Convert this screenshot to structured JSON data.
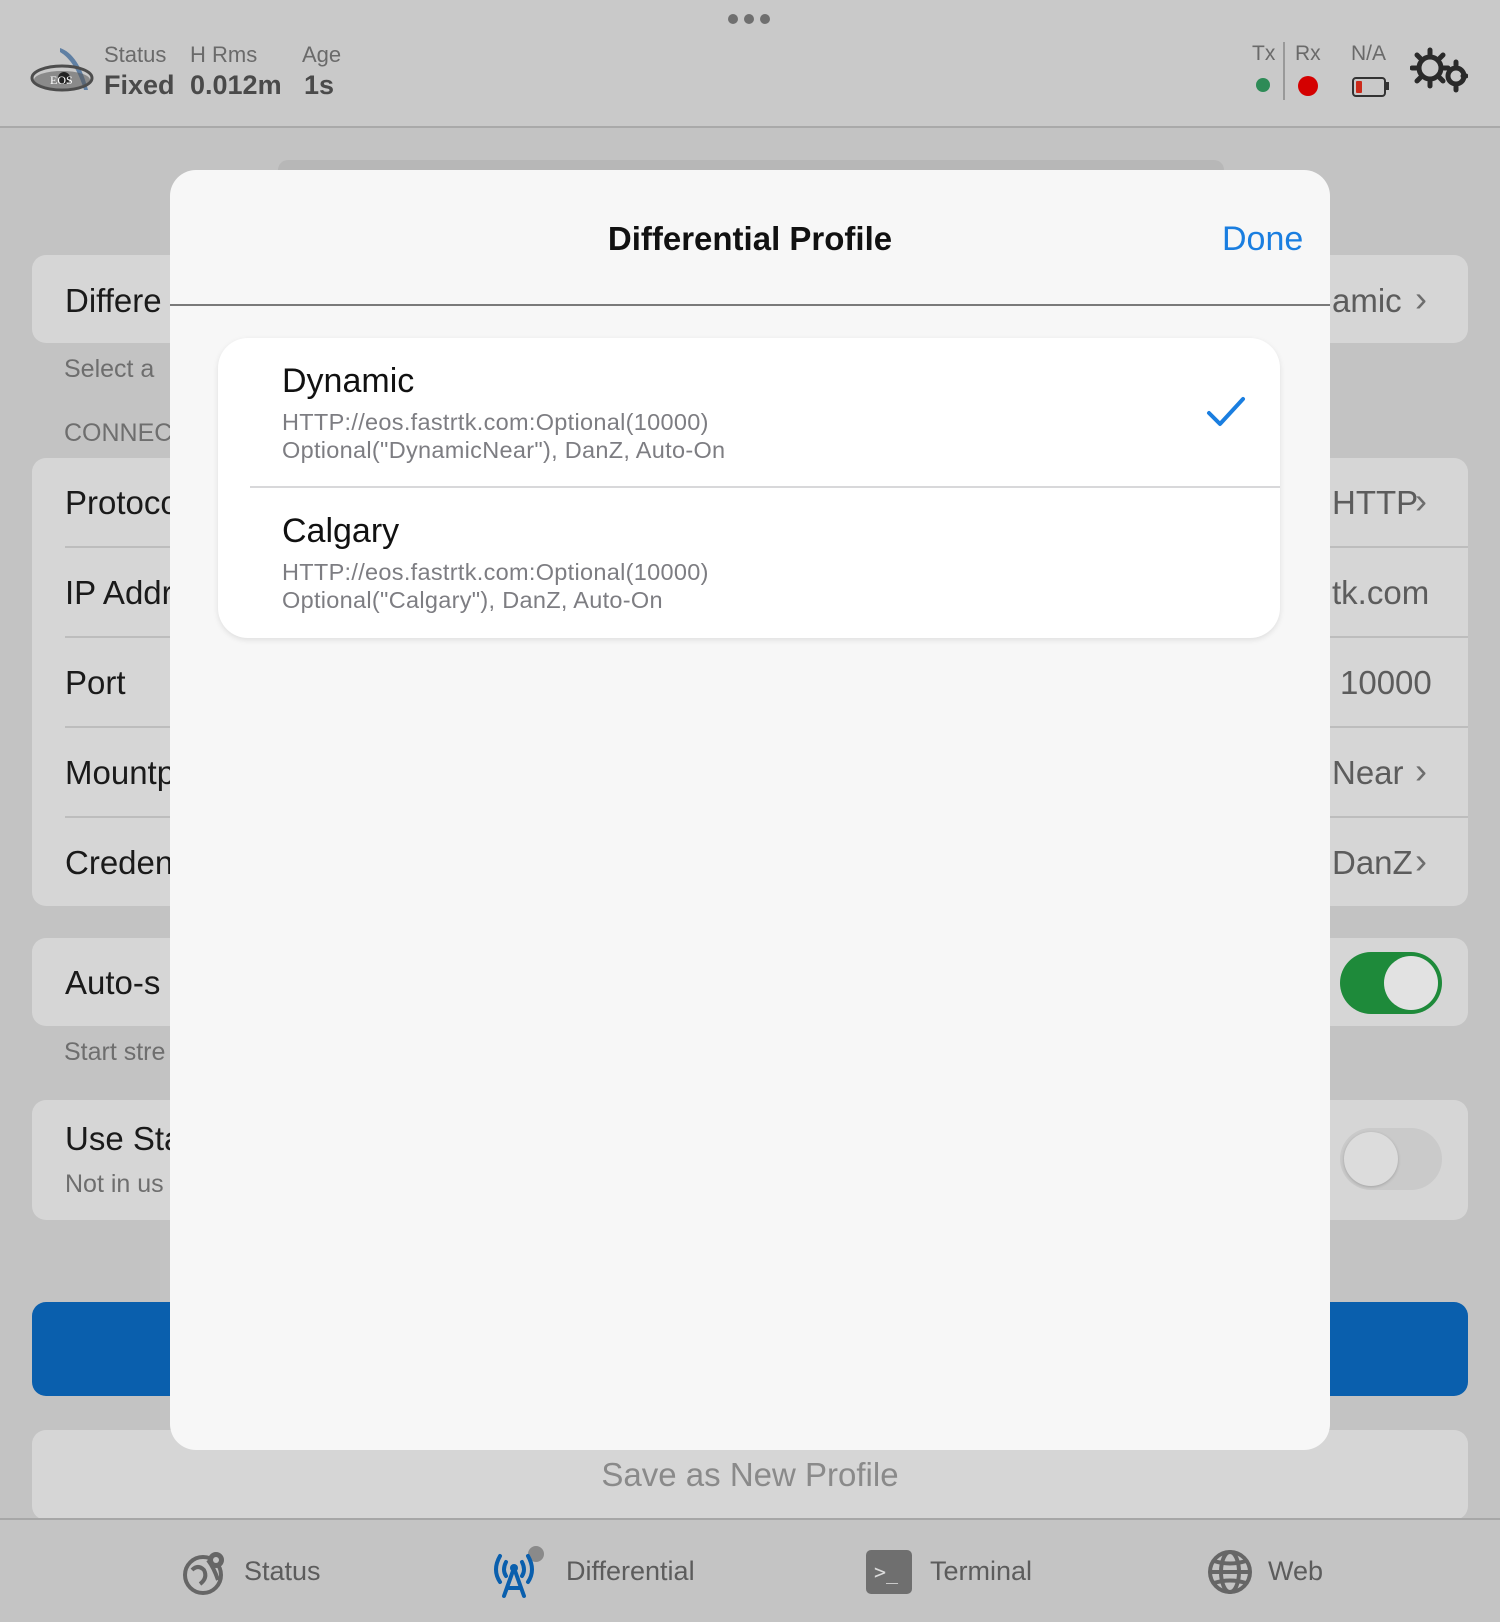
{
  "status_bar": {
    "status_label": "Status",
    "status_value": "Fixed",
    "hrms_label": "H Rms",
    "hrms_value": "0.012m",
    "age_label": "Age",
    "age_value": "1s",
    "tx_label": "Tx",
    "rx_label": "Rx",
    "battery_label": "N/A",
    "colors": {
      "tx_dot": "#2e8b57",
      "rx_dot": "#d40000",
      "battery": "#cc2a1a"
    }
  },
  "logo": {
    "text": "EOS"
  },
  "background": {
    "profile_row": {
      "label": "Differe",
      "value": "amic"
    },
    "profile_sub": "Select a",
    "section_header": "CONNEC",
    "connection_rows": [
      {
        "label": "Protoco",
        "value": "HTTP"
      },
      {
        "label": "IP Addr",
        "value": "tk.com"
      },
      {
        "label": "Port",
        "value": "10000"
      },
      {
        "label": "Mountp",
        "value": "Near"
      },
      {
        "label": "Creden",
        "value": "DanZ"
      }
    ],
    "auto_row": {
      "label": "Auto-s",
      "sub": "Start stre",
      "toggle_on": true
    },
    "use_row": {
      "label": "Use Sta",
      "sub": "Not in us",
      "toggle_on": false
    },
    "save_new_profile": "Save as New Profile",
    "colors": {
      "primary_button": "#0a5fad",
      "toggle_on": "#1e8a3a"
    }
  },
  "modal": {
    "title": "Differential Profile",
    "done_label": "Done",
    "options": [
      {
        "title": "Dynamic",
        "line1": "HTTP://eos.fastrtk.com:Optional(10000)",
        "line2": "Optional(\"DynamicNear\"), DanZ, Auto-On",
        "selected": true
      },
      {
        "title": "Calgary",
        "line1": "HTTP://eos.fastrtk.com:Optional(10000)",
        "line2": "Optional(\"Calgary\"), DanZ, Auto-On",
        "selected": false
      }
    ],
    "accent": "#1a7ee0"
  },
  "tabs": [
    {
      "label": "Status",
      "icon": "globe-pin-icon"
    },
    {
      "label": "Differential",
      "icon": "antenna-tower-icon"
    },
    {
      "label": "Terminal",
      "icon": "terminal-icon"
    },
    {
      "label": "Web",
      "icon": "globe-icon"
    }
  ]
}
